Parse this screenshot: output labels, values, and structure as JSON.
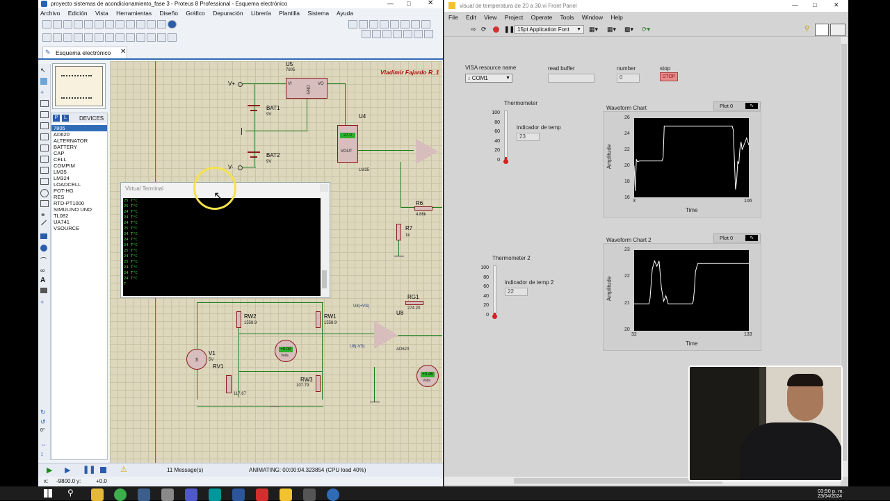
{
  "proteus": {
    "title": "proyecto sistemas de acondicionamiento_fase 3 - Proteus 8 Professional - Esquema electrónico",
    "menu": [
      "Archivo",
      "Edición",
      "Vista",
      "Herramientas",
      "Diseño",
      "Gráfico",
      "Depuración",
      "Librería",
      "Plantilla",
      "Sistema",
      "Ayuda"
    ],
    "tab": "Esquema electrónico",
    "devices_header": "DEVICES",
    "devices": [
      "7805",
      "AD620",
      "ALTERNATOR",
      "BATTERY",
      "CAP",
      "CELL",
      "COMPIM",
      "LM35",
      "LM324",
      "LOADCELL",
      "POT-HG",
      "RES",
      "RTD-PT1000",
      "SIMULINO UNO",
      "TL082",
      "UA741",
      "VSOURCE"
    ],
    "selected_device": "7805",
    "author": "Vladimir Fajardo R_1",
    "components": {
      "u5": "U5",
      "u5_part": "7805",
      "u5_vi": "VI",
      "u5_vo": "VO",
      "u5_gnd": "GND",
      "bat1": "BAT1",
      "bat1_v": "9V",
      "bat2": "BAT2",
      "bat2_v": "9V",
      "vplus": "V+",
      "vminus": "V-",
      "u4": "U4",
      "u4_part": "LM35",
      "u4_vout": "VOUT",
      "u4_display": "27.0",
      "r6": "R6",
      "r6_val": "4.86k",
      "r7": "R7",
      "r7_val": "1k",
      "rw2": "RW2",
      "rw2_val": "1558.9",
      "rw1": "RW1",
      "rw1_val": "1558.9",
      "rw3": "RW3",
      "rw3_val": "107.79",
      "rv1": "RV1",
      "rv1_val": "117.67",
      "v1": "V1",
      "v1_val": "5V",
      "rg1": "RG1",
      "rg1_val": "274.20",
      "u8": "U8",
      "u8_part": "AD620",
      "u8_vs_pos": "U8(+VS)",
      "u8_vs_neg": "U8(-VS)",
      "volt_display1": "+0.00",
      "volt_display2": "+3.46",
      "volts": "Volts"
    },
    "terminal": {
      "title": "Virtual Terminal",
      "lines": [
        "25 T°C",
        "25 T°C",
        "24 T°C",
        "24 T°C",
        "24 T°C",
        "25 T°C",
        "24 T°C",
        "24 T°C",
        "24 T°C",
        "25 T°C",
        "24 T°C",
        "25 T°C",
        "24 T°C",
        "24 T°C",
        "24 T°C",
        "T"
      ]
    },
    "status": {
      "messages": "11 Message(s)",
      "animating": "ANIMATING: 00:00:04.323854 (CPU load 40%)",
      "coord_x_label": "x:",
      "coord_x": "-9800.0",
      "coord_y_label": "y:",
      "coord_y": "+0.0"
    }
  },
  "labview": {
    "title": "visual de temperatura de 20 a 30.vi Front Panel",
    "menu": [
      "File",
      "Edit",
      "View",
      "Project",
      "Operate",
      "Tools",
      "Window",
      "Help"
    ],
    "font_select": "15pt Application Font",
    "visa_label": "VISA resource name",
    "visa_value": "COM1",
    "read_buffer_label": "read buffer",
    "read_buffer_value": "",
    "number_label": "number",
    "number_value": "0",
    "stop_label": "stop",
    "stop_button": "STOP",
    "thermo1": {
      "label": "Thermometer",
      "scale": [
        "100",
        "80",
        "60",
        "40",
        "20",
        "0"
      ],
      "indicator_label": "indicador de temp",
      "indicator_value": "23",
      "level_fraction": 0.08
    },
    "thermo2": {
      "label": "Thermometer 2",
      "scale": [
        "100",
        "80",
        "60",
        "40",
        "20",
        "0"
      ],
      "indicator_label": "indicador de temp 2",
      "indicator_value": "22",
      "level_fraction": 0.07
    },
    "chart1": {
      "title": "Waveform Chart",
      "plot_legend": "Plot 0",
      "ylabel": "Amplitude",
      "xlabel": "Time",
      "yticks": [
        "26",
        "24",
        "22",
        "20",
        "18",
        "16"
      ],
      "xmin": "3",
      "xmax": "106"
    },
    "chart2": {
      "title": "Waveform Chart 2",
      "plot_legend": "Plot 0",
      "ylabel": "Amplitude",
      "xlabel": "Time",
      "yticks": [
        "23",
        "22",
        "21",
        "20"
      ],
      "xmin": "32",
      "xmax": "133"
    }
  },
  "chart_data": [
    {
      "type": "line",
      "title": "Waveform Chart",
      "xlabel": "Time",
      "ylabel": "Amplitude",
      "xlim": [
        3,
        106
      ],
      "ylim": [
        16,
        26
      ],
      "series": [
        {
          "name": "Plot 0",
          "x": [
            3,
            4,
            5,
            6,
            8,
            20,
            28,
            29,
            30,
            40,
            60,
            70,
            91,
            92,
            93,
            94,
            95,
            96,
            97,
            98,
            99,
            100,
            104,
            106
          ],
          "y": [
            20,
            16.8,
            20.8,
            20.5,
            20.6,
            20.6,
            20.6,
            21,
            25,
            25,
            25,
            25,
            25,
            24.5,
            20.8,
            17,
            18,
            20.5,
            20.3,
            22.2,
            23,
            22,
            23.5,
            22.6
          ]
        }
      ]
    },
    {
      "type": "line",
      "title": "Waveform Chart 2",
      "xlabel": "Time",
      "ylabel": "Amplitude",
      "xlim": [
        32,
        133
      ],
      "ylim": [
        20,
        23
      ],
      "series": [
        {
          "name": "Plot 0",
          "x": [
            32,
            33,
            34,
            45,
            46,
            48,
            50,
            52,
            54,
            56,
            58,
            60,
            62,
            80,
            83,
            84,
            85,
            86,
            88,
            90,
            100,
            133
          ],
          "y": [
            21,
            21,
            21,
            21,
            21.2,
            22.3,
            22.6,
            22.4,
            22.6,
            21.6,
            21.1,
            21.3,
            21,
            21,
            21,
            21.1,
            21.5,
            22.2,
            22.5,
            22.5,
            22.5,
            22.5
          ]
        }
      ]
    }
  ],
  "taskbar": {
    "time": "03:50 p. m.",
    "date": "23/04/2024"
  }
}
